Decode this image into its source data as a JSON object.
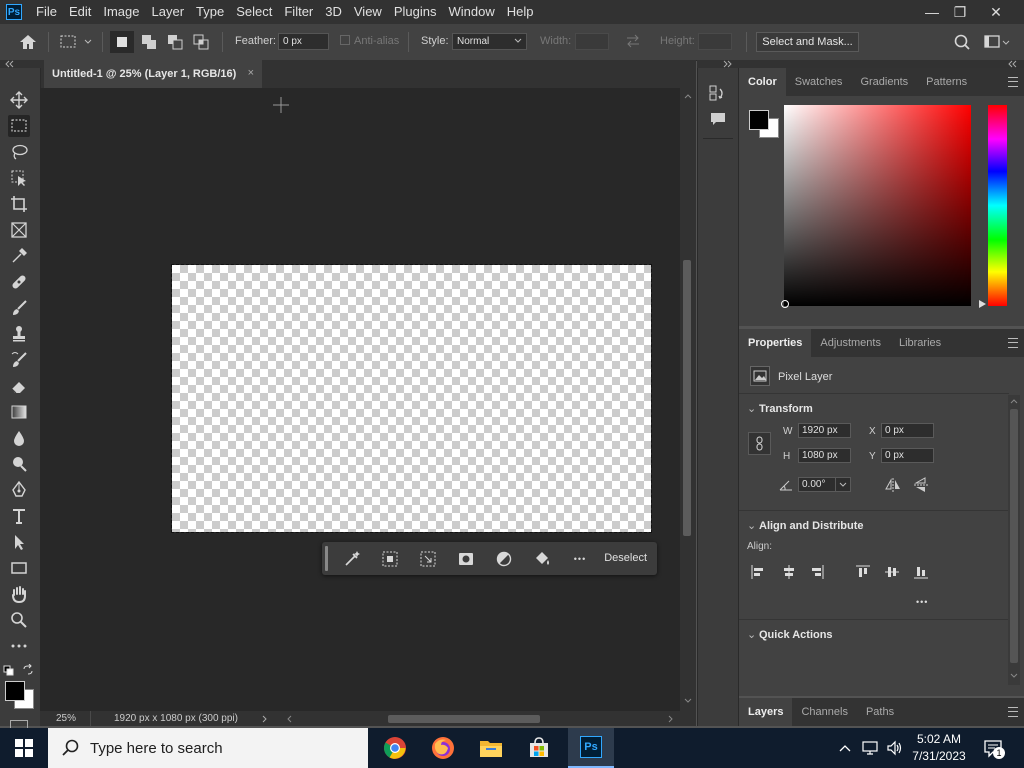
{
  "menu": {
    "logo": "Ps",
    "items": [
      "File",
      "Edit",
      "Image",
      "Layer",
      "Type",
      "Select",
      "Filter",
      "3D",
      "View",
      "Plugins",
      "Window",
      "Help"
    ],
    "min_symbol": "—",
    "restore_symbol": "❐",
    "close_symbol": "✕"
  },
  "options": {
    "feather_label": "Feather:",
    "feather_value": "0 px",
    "antialias_label": "Anti-alias",
    "style_label": "Style:",
    "style_value": "Normal",
    "width_label": "Width:",
    "height_label": "Height:",
    "select_mask_label": "Select and Mask..."
  },
  "document": {
    "tab_title": "Untitled-1 @ 25% (Layer 1, RGB/16)",
    "tab_close": "×"
  },
  "context_bar": {
    "deselect_label": "Deselect",
    "more_symbol": "•••"
  },
  "status": {
    "zoom": "25%",
    "doc_info": "1920 px x 1080 px (300 ppi)"
  },
  "color_panel": {
    "tabs": [
      "Color",
      "Swatches",
      "Gradients",
      "Patterns"
    ],
    "active_tab": "Color",
    "foreground": "#000000",
    "background": "#ffffff",
    "hue_color": "#ff0000"
  },
  "properties_panel": {
    "tabs": [
      "Properties",
      "Adjustments",
      "Libraries"
    ],
    "active_tab": "Properties",
    "layer_type": "Pixel Layer",
    "transform_title": "Transform",
    "w_label": "W",
    "w_value": "1920 px",
    "h_label": "H",
    "h_value": "1080 px",
    "x_label": "X",
    "x_value": "0 px",
    "y_label": "Y",
    "y_value": "0 px",
    "angle_value": "0.00°",
    "align_title": "Align and Distribute",
    "align_label": "Align:",
    "align_more": "•••",
    "quick_actions_title": "Quick Actions"
  },
  "layers_panel": {
    "tabs": [
      "Layers",
      "Channels",
      "Paths"
    ],
    "active_tab": "Layers"
  },
  "taskbar": {
    "search_placeholder": "Type here to search",
    "time": "5:02 AM",
    "date": "7/31/2023",
    "notification_count": "1",
    "ps_label": "Ps"
  }
}
